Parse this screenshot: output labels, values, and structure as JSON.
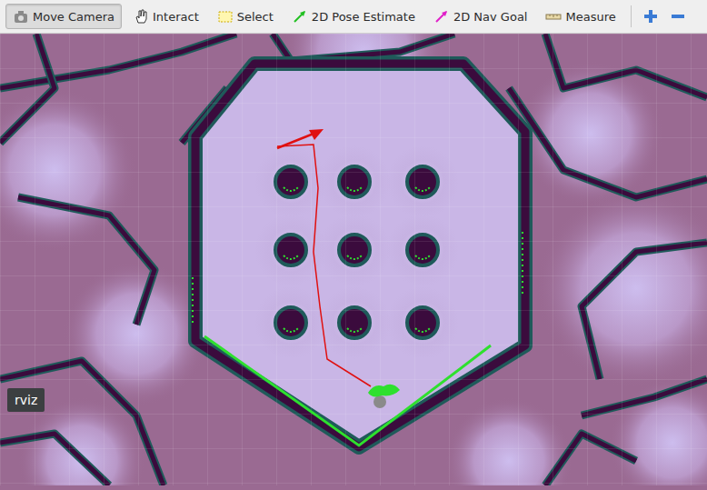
{
  "toolbar": {
    "tools": [
      {
        "label": "Move Camera",
        "selected": true
      },
      {
        "label": "Interact",
        "selected": false
      },
      {
        "label": "Select",
        "selected": false
      },
      {
        "label": "2D Pose Estimate",
        "selected": false
      },
      {
        "label": "2D Nav Goal",
        "selected": false
      },
      {
        "label": "Measure",
        "selected": false
      }
    ]
  },
  "tooltip": {
    "text": "rviz"
  }
}
